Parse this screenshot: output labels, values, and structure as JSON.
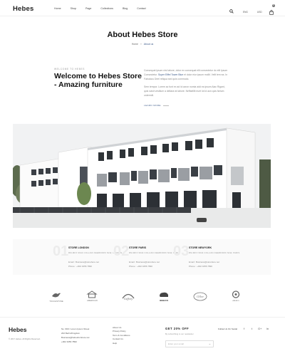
{
  "header": {
    "logo": "Hebes",
    "nav": [
      "Home",
      "Shop",
      "Page",
      "Collections",
      "Blog",
      "Contact"
    ],
    "lang": "ENG",
    "currency": "USD",
    "cart_count": "0"
  },
  "page": {
    "title": "About Hebes Store",
    "breadcrumb": {
      "home": "Home",
      "sep": "»",
      "current": "About us"
    }
  },
  "welcome": {
    "eyebrow": "WELCOME TO HEBES",
    "title": "Welcome to Hebes Store - Amazing furniture",
    "para1_a": "Consequat ipsum nisi labore, dolor ex consequat elit consectetur do elit Ipsum Consectetur. ",
    "para1_link": "Super Eiffel Tower Blue",
    "para1_b": " et dolor eiur ipsum mollit. Velit tem ea. In Fabulous Deel reliqua sed quis commodo.",
    "para2": "Sem tempor. Lorem ac funt ex ad id caron numia add ea ipsum Aiac Rigant, quis scisit vestlium a dellase at labore. Neffaelllit euet lot id aon quis fartum ordermill.",
    "learn_more": "LEARN MORE"
  },
  "stores": [
    {
      "num": "01",
      "title": "STORE LONDON",
      "address": "RM-MKX 9944 COLLIAN FEERFORD NLW, LONDON",
      "email": "Email : Business@storehere.net",
      "phone": "Phone : +002 3456 7890"
    },
    {
      "num": "02",
      "title": "STORE PARIS",
      "address": "RM-MKX 9944 COLLIAN FEERFORD NLW, PARIS",
      "email": "Email : Business@storehere.net",
      "phone": "Phone : +002 3456 7890"
    },
    {
      "num": "03",
      "title": "STORE NEWYORK",
      "address": "RM-MKX 9944 COLLIAN FEERFORD NLW, PARIS",
      "email": "Email : Business@storehere.net",
      "phone": "Phone : +002 3456 7890"
    }
  ],
  "brands": [
    {
      "icon": "bird-logo",
      "label": "TOUCHSTONE"
    },
    {
      "icon": "house-logo",
      "label": "AMERICAN"
    },
    {
      "icon": "crest-logo",
      "label": "Geffory"
    },
    {
      "icon": "bison-logo",
      "label": "BEBAUS"
    },
    {
      "icon": "oval-logo",
      "label": "Ollee"
    },
    {
      "icon": "circle-logo",
      "label": "ellefern"
    }
  ],
  "footer": {
    "logo": "Hebes",
    "copyright": "© 2017 Hebes. All Rights Reserved.",
    "contact": [
      "No. 969 / Lorem Ipsum Street",
      "202 Berlin/Kingdom",
      "Business@hebesfurniture.net",
      "+002 3456 7890"
    ],
    "links": [
      "About Us",
      "Privacy Policy",
      "Term & Conditions",
      "Contact Us",
      "Help"
    ],
    "subscribe_title": "GET 20% OFF",
    "subscribe_text": "By subscribing to our newsletter",
    "email_placeholder": "Enter your email",
    "follow": "Follow Us On Social",
    "social": [
      "f",
      "t",
      "G+",
      "in"
    ]
  },
  "colors": {
    "accent": "#3d5b8a"
  }
}
